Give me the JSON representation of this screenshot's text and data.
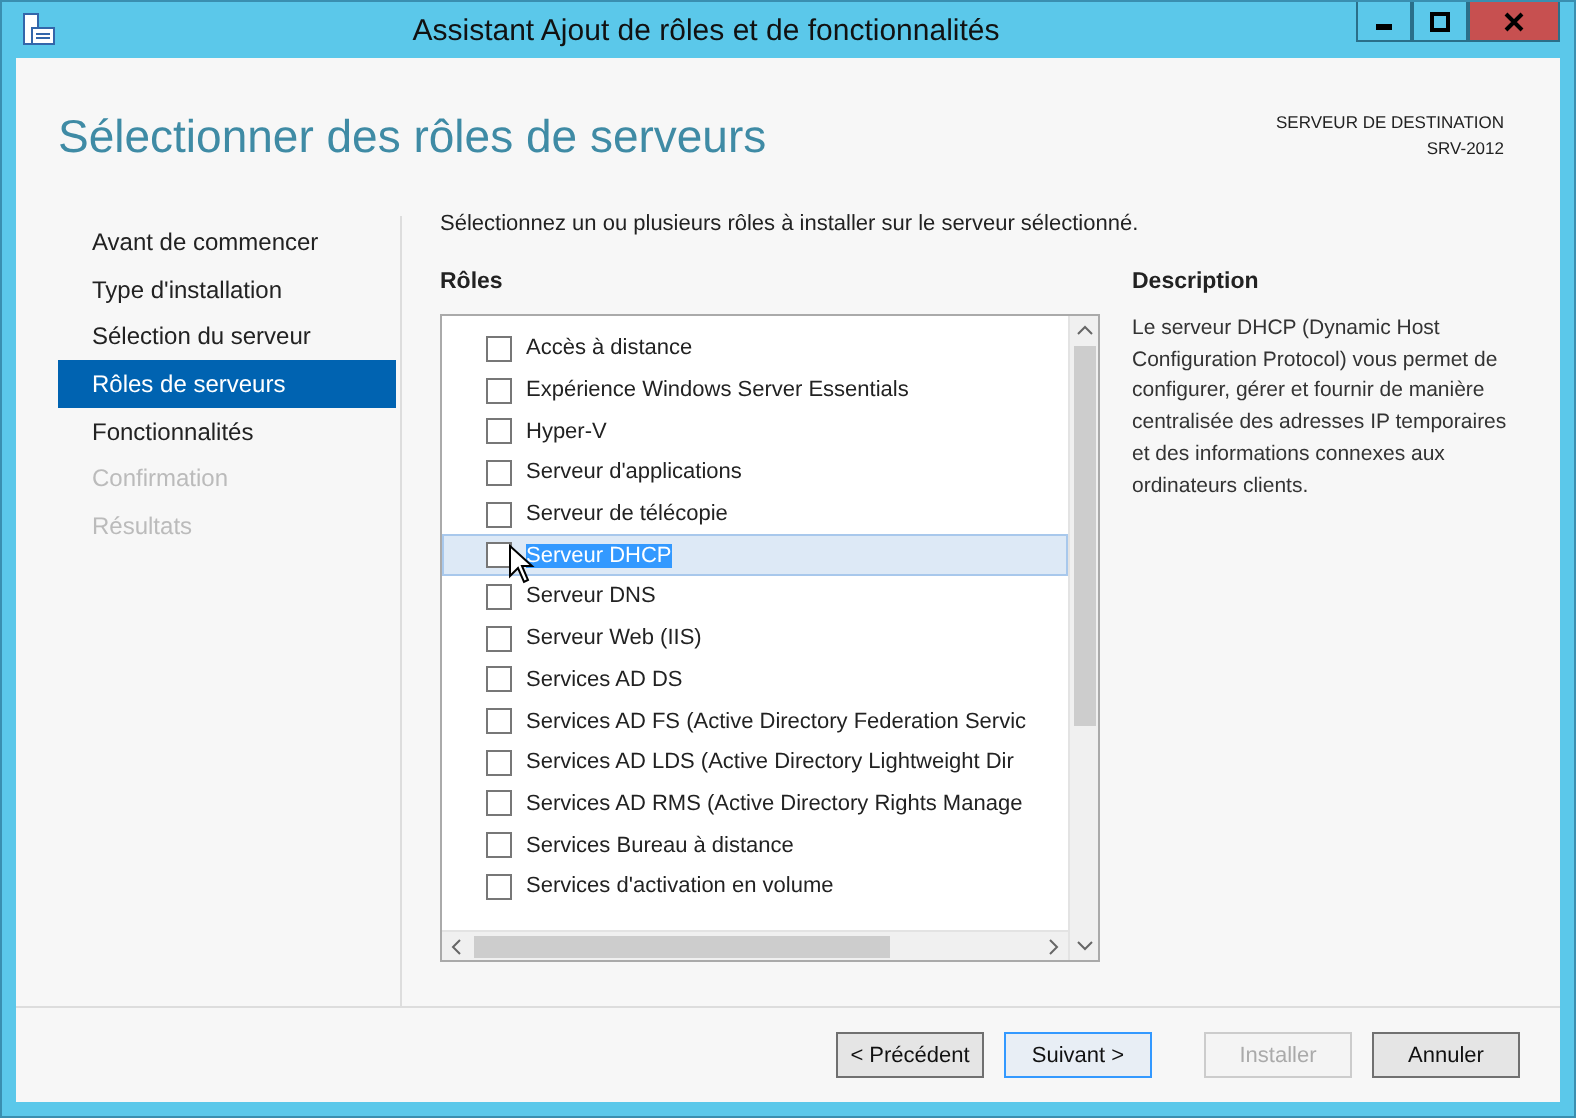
{
  "window": {
    "title": "Assistant Ajout de rôles et de fonctionnalités"
  },
  "header": {
    "title": "Sélectionner des rôles de serveurs",
    "destination_label": "SERVEUR DE DESTINATION",
    "destination_server": "SRV-2012"
  },
  "sidebar": {
    "items": [
      {
        "label": "Avant de commencer",
        "selected": false,
        "disabled": false
      },
      {
        "label": "Type d'installation",
        "selected": false,
        "disabled": false
      },
      {
        "label": "Sélection du serveur",
        "selected": false,
        "disabled": false
      },
      {
        "label": "Rôles de serveurs",
        "selected": true,
        "disabled": false
      },
      {
        "label": "Fonctionnalités",
        "selected": false,
        "disabled": false
      },
      {
        "label": "Confirmation",
        "selected": false,
        "disabled": true
      },
      {
        "label": "Résultats",
        "selected": false,
        "disabled": true
      }
    ]
  },
  "instruction": "Sélectionnez un ou plusieurs rôles à installer sur le serveur sélectionné.",
  "roles": {
    "heading": "Rôles",
    "items": [
      {
        "label": "Accès à distance",
        "checked": false,
        "selected": false
      },
      {
        "label": "Expérience Windows Server Essentials",
        "checked": false,
        "selected": false
      },
      {
        "label": "Hyper-V",
        "checked": false,
        "selected": false
      },
      {
        "label": "Serveur d'applications",
        "checked": false,
        "selected": false
      },
      {
        "label": "Serveur de télécopie",
        "checked": false,
        "selected": false
      },
      {
        "label": "Serveur DHCP",
        "checked": false,
        "selected": true
      },
      {
        "label": "Serveur DNS",
        "checked": false,
        "selected": false
      },
      {
        "label": "Serveur Web (IIS)",
        "checked": false,
        "selected": false
      },
      {
        "label": "Services AD DS",
        "checked": false,
        "selected": false
      },
      {
        "label": "Services AD FS (Active Directory Federation Servic",
        "checked": false,
        "selected": false
      },
      {
        "label": "Services AD LDS (Active Directory Lightweight Dir",
        "checked": false,
        "selected": false
      },
      {
        "label": "Services AD RMS (Active Directory Rights Manage",
        "checked": false,
        "selected": false
      },
      {
        "label": "Services Bureau à distance",
        "checked": false,
        "selected": false
      },
      {
        "label": "Services d'activation en volume",
        "checked": false,
        "selected": false
      }
    ]
  },
  "description": {
    "heading": "Description",
    "text": "Le serveur DHCP (Dynamic Host Configuration Protocol) vous permet de configurer, gérer et fournir de manière centralisée des adresses IP temporaires et des informations connexes aux ordinateurs clients."
  },
  "buttons": [
    {
      "label": "< Précédent",
      "default": false,
      "disabled": false
    },
    {
      "label": "Suivant >",
      "default": true,
      "disabled": false
    },
    {
      "label": "Installer",
      "default": false,
      "disabled": true
    },
    {
      "label": "Annuler",
      "default": false,
      "disabled": false
    }
  ]
}
